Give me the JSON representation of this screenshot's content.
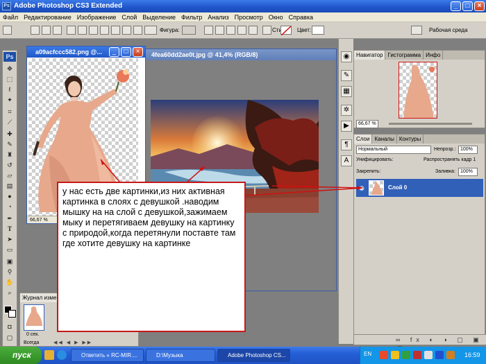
{
  "window": {
    "title": "Adobe Photoshop CS3 Extended",
    "logo_text": "Ps",
    "controls": [
      "minimize",
      "maximize",
      "close"
    ]
  },
  "menu": [
    "Файл",
    "Редактирование",
    "Изображение",
    "Слой",
    "Выделение",
    "Фильтр",
    "Анализ",
    "Просмотр",
    "Окно",
    "Справка"
  ],
  "options": {
    "shape_label": "Фигура:",
    "style_label": "Стиль:",
    "color_label": "Цвет:",
    "workspace_label": "Рабочая среда"
  },
  "toolbox": {
    "logo": "Ps",
    "tools": [
      "move-tool",
      "marquee-tool",
      "lasso-tool",
      "magic-wand-tool",
      "crop-tool",
      "slice-tool",
      "healing-tool",
      "brush-tool",
      "clone-stamp-tool",
      "history-brush-tool",
      "eraser-tool",
      "gradient-tool",
      "blur-tool",
      "dodge-tool",
      "pen-tool",
      "type-tool",
      "path-selection-tool",
      "shape-tool",
      "notes-tool",
      "eyedropper-tool",
      "hand-tool",
      "zoom-tool"
    ]
  },
  "doc1": {
    "title": "a09acfccc582.png @...",
    "zoom": "66,67 %"
  },
  "doc2": {
    "title": "4fea60dd2ae0t.jpg @ 41,4% (RGB/8)"
  },
  "navigator": {
    "tabs": [
      "Навигатор",
      "Гистограмма",
      "Инфо"
    ],
    "zoom": "66,67 %"
  },
  "layers": {
    "tabs": [
      "Слои",
      "Каналы",
      "Контуры"
    ],
    "blend_mode": "Нормальный",
    "opacity_label": "Непрозр.:",
    "opacity_value": "100%",
    "unify_label": "Унифицировать:",
    "propagate_label": "Распространять кадр 1",
    "lock_label": "Закрепить:",
    "fill_label": "Заливка:",
    "fill_value": "100%",
    "layer_name": "Слой 0"
  },
  "history": {
    "tab": "Журнал изме",
    "frame_time": "0 сек.",
    "loop_label": "Всегда"
  },
  "annotation": "у нас есть две картинки,из них активная  картинка в слоях с девушкой .наводим мышку на на слой с девушкой,зажимаем мыку и перетягиваем девушку на картинку с природой,когда перетянули поставте там где хотите девушку на картинке",
  "taskbar": {
    "start": "пуск",
    "items": [
      "Ответить « RC-MIR....",
      "D:\\Музыка",
      "Adobe Photoshop CS..."
    ],
    "language": "EN",
    "clock": "16:59"
  },
  "colors": {
    "accent": "#245ed6",
    "annotation_border": "#c61818",
    "selected_layer": "#3160b8"
  }
}
